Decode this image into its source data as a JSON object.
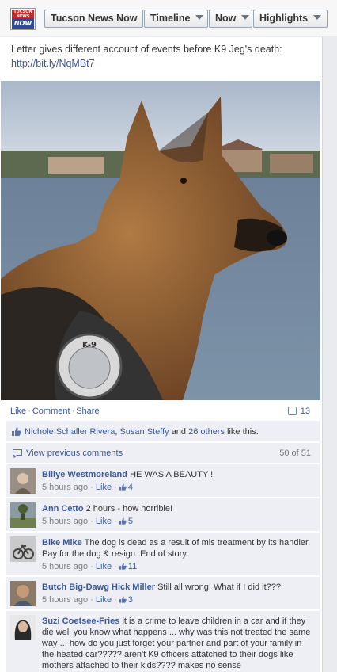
{
  "header": {
    "logo_text_top": "TUCSON NEWS",
    "logo_text_bottom": "NOW",
    "page_name": "Tucson News Now",
    "tabs": [
      {
        "label": "Timeline"
      },
      {
        "label": "Now"
      },
      {
        "label": "Highlights"
      }
    ]
  },
  "post": {
    "text": "Letter gives different account of events before K9 Jeg's death:",
    "link": "http://bit.ly/NqMBt7",
    "photo_patch_text": "K-9",
    "actions": {
      "like": "Like",
      "comment": "Comment",
      "share": "Share"
    },
    "comment_count": "13",
    "likes": {
      "person1": "Nichole Schaller Rivera",
      "person2": "Susan Steffy",
      "and": "and",
      "others": "26 others",
      "suffix": "like this."
    },
    "view_previous": "View previous comments",
    "view_count": "50 of 51"
  },
  "comments": [
    {
      "name": "Billye Westmoreland",
      "text": "HE WAS A BEAUTY !",
      "time": "5 hours ago",
      "like": "Like",
      "likes": "4"
    },
    {
      "name": "Ann Cetto",
      "text": "2 hours - how horrible!",
      "time": "5 hours ago",
      "like": "Like",
      "likes": "5"
    },
    {
      "name": "Bike Mike",
      "text": "The dog is dead as a result of mis treatment by its handler. Pay for the dog & resign. End of story.",
      "time": "5 hours ago",
      "like": "Like",
      "likes": "11"
    },
    {
      "name": "Butch Big-Dawg Hick Miller",
      "text": "Still all wrong! What if I did it???",
      "time": "5 hours ago",
      "like": "Like",
      "likes": "3"
    },
    {
      "name": "Suzi Coetsee-Fries",
      "text": "it is a crime to leave children in a car and if they die well you know what happens ... why was this not treated the same way ... how do you just forget your partner and part of your family in the heated car????? aren't K9 officers attatched to their dogs like mothers attached to their kids???? makes no sense",
      "time": "",
      "like": "",
      "likes": ""
    }
  ],
  "colors": {
    "link": "#3b5998",
    "ufi_bg": "#edeff4",
    "logo_red": "#c62a2a",
    "logo_blue": "#2c4b94"
  }
}
